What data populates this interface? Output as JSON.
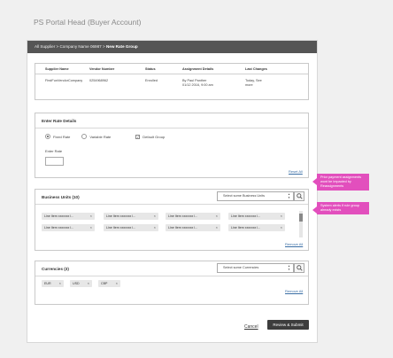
{
  "page": {
    "title": "PS Portal Head (Buyer Account)"
  },
  "breadcrumb": {
    "trail": "All Supplier > Company Name 06987 >",
    "current": "New Rate Group"
  },
  "supplier_table": {
    "headers": [
      "Supplier Name",
      "Vendor Number",
      "Status",
      "Assignment Details",
      "Last Changes"
    ],
    "row": {
      "name": "FirstFunVendorCompany",
      "vendor": "0254968962",
      "status": "Enrolled",
      "assignment_by": "By Paul Panther",
      "assignment_date": "01/12 2016, 9:00 am",
      "last_changes_1": "Today,",
      "last_changes_2": "See",
      "last_changes_3": "more"
    }
  },
  "rate_details": {
    "title": "Enter Rate Details",
    "fixed_rate": "Fixed Rate",
    "variable_rate": "Variable Rate",
    "default_group": "Default Group",
    "enter_rate": "Enter Rate",
    "reset": "Reset All"
  },
  "business_units": {
    "title": "Business Units (10)",
    "placeholder": "Select some Business Units",
    "chips": [
      "Line Item xxxxxxx l...",
      "Line Item xxxxxxx l...",
      "Line Item xxxxxxx l...",
      "Line Item xxxxxxx l...",
      "Line Item xxxxxxx l...",
      "Line Item xxxxxxx l...",
      "Line Item xxxxxxx l...",
      "Line Item xxxxxxx l..."
    ],
    "remove_all": "Remove All"
  },
  "currencies": {
    "title": "Currencies (3)",
    "placeholder": "Select some Currencies",
    "chips": [
      "EUR",
      "USD",
      "CBP"
    ],
    "remove_all": "Remove All"
  },
  "notes": {
    "prior_payment": "Prior payment assignments wont be impacted by Reassignments",
    "system_alert": "System alerts if rule group already exists"
  },
  "actions": {
    "cancel": "Cancel",
    "submit": "Review & Submit"
  },
  "icons": {
    "search": "search-icon",
    "remove": "close-icon",
    "select": "chevron-updown-icon"
  },
  "colors": {
    "accent_note": "#e24fbd",
    "header_bar": "#555555",
    "primary_button": "#3d3d3d",
    "link": "#3a6ea5"
  }
}
